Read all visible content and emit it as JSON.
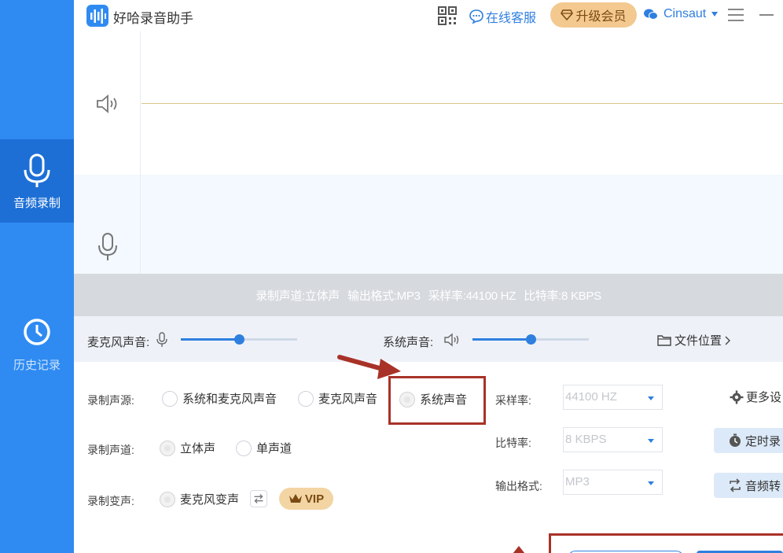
{
  "sidebar": {
    "items": [
      {
        "label": "音频录制",
        "icon": "microphone-icon",
        "active": true
      },
      {
        "label": "历史记录",
        "icon": "clock-icon",
        "active": false
      }
    ]
  },
  "titlebar": {
    "app_title": "好哈录音助手",
    "service_label": "在线客服",
    "upgrade_label": "升级会员",
    "username": "Cinsaut"
  },
  "status": {
    "channel": "录制声道:立体声",
    "format": "输出格式:MP3",
    "sample_rate": "采样率:44100 HZ",
    "bit_rate": "比特率:8 KBPS"
  },
  "volume": {
    "mic_label": "麦克风声音:",
    "mic_level": 0.5,
    "system_label": "系统声音:",
    "system_level": 0.5,
    "file_location_label": "文件位置"
  },
  "settings": {
    "source_label": "录制声源:",
    "source_options": [
      "系统和麦克风声音",
      "麦克风声音",
      "系统声音"
    ],
    "source_selected": "系统声音",
    "channel_label": "录制声道:",
    "channel_options": [
      "立体声",
      "单声道"
    ],
    "channel_selected": "立体声",
    "voice_change_label": "录制变声:",
    "voice_change_option": "麦克风变声",
    "vip_label": "VIP",
    "sample_rate_label": "采样率:",
    "sample_rate_value": "44100 HZ",
    "bit_rate_label": "比特率:",
    "bit_rate_value": "8 KBPS",
    "output_format_label": "输出格式:",
    "output_format_value": "MP3",
    "more_settings_label": "更多设",
    "timer_label": "定时录",
    "convert_label": "音频转"
  },
  "colors": {
    "sidebar": "#2f8bf2",
    "sidebar_active": "#1d6fd6",
    "accent": "#2f7fdf",
    "highlight_annotation": "#a83227",
    "vip": "#f3d4a3"
  }
}
